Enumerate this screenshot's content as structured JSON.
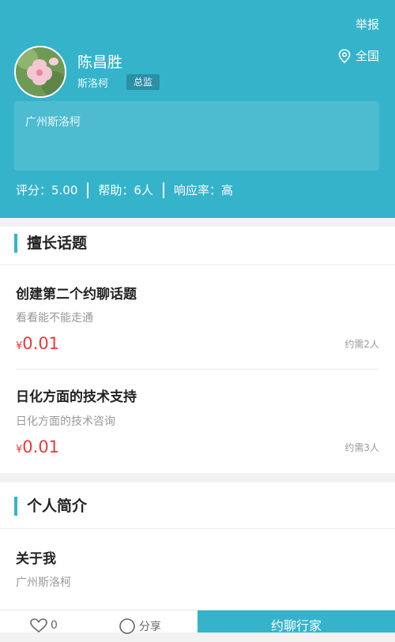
{
  "header": {
    "report": "举报",
    "name": "陈昌胜",
    "company": "斯洛柯",
    "title_badge": "总监",
    "region": "全国",
    "address": "广州斯洛柯",
    "stats": {
      "score": "评分：5.00",
      "help": "帮助：6人",
      "response": "响应率：高"
    }
  },
  "topics": {
    "title": "擅长话题",
    "items": [
      {
        "title": "创建第二个约聊话题",
        "desc": "看看能不能走通",
        "currency": "¥",
        "price": "0.01",
        "need": "约需2人"
      },
      {
        "title": "日化方面的技术支持",
        "desc": "日化方面的技术咨询",
        "currency": "¥",
        "price": "0.01",
        "need": "约需3人"
      }
    ]
  },
  "profile": {
    "title": "个人简介",
    "about_title": "关于我",
    "about_text": "广州斯洛柯"
  },
  "bottom_bar": {
    "like_count": "0",
    "share_label": "分享",
    "book_label": "约聊行家"
  },
  "colors": {
    "accent": "#35b3cb",
    "price": "#e83a3a"
  }
}
